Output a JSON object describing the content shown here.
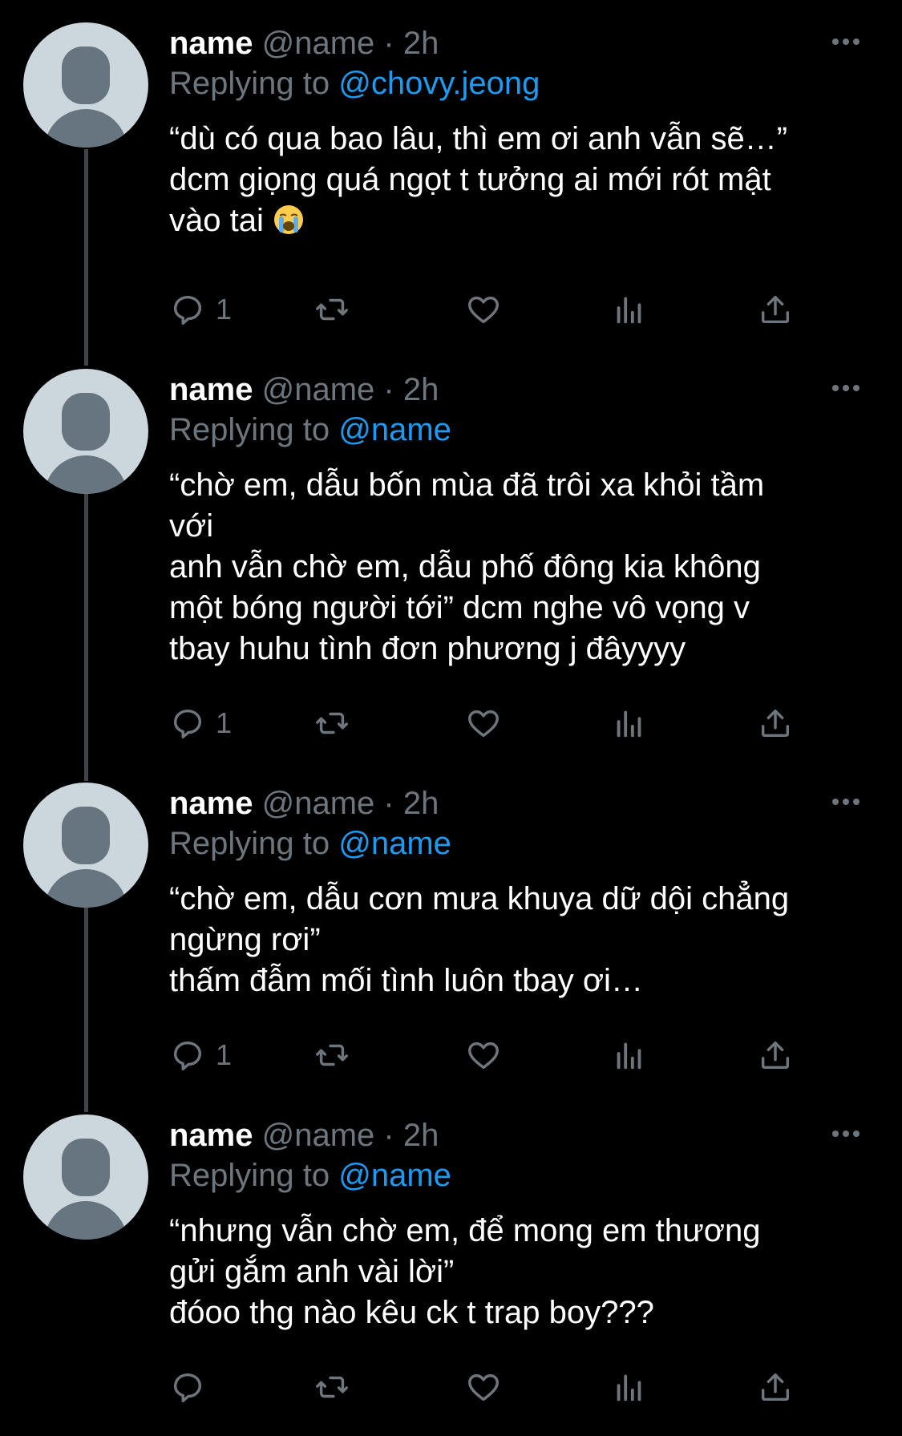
{
  "colors": {
    "background": "#000000",
    "secondary_text": "#6e767d",
    "mention": "#1d9bf0",
    "avatar_bg": "#ccd6dd",
    "avatar_fg": "#66757f",
    "thread_line": "#3f4448"
  },
  "tweets": [
    {
      "name": "name",
      "handle": "@name",
      "dot": "·",
      "time": "2h",
      "replying_prefix": "Replying to",
      "replying_to": "@chovy.jeong",
      "text": "“dù có qua bao lâu, thì em ơi anh vẫn sẽ…”\ndcm giọng quá ngọt t tưởng ai mới rót mật\nvào tai",
      "emoji": "loudly-crying-face-icon",
      "reply_count": "1"
    },
    {
      "name": "name",
      "handle": "@name",
      "dot": "·",
      "time": "2h",
      "replying_prefix": "Replying to",
      "replying_to": "@name",
      "text": "“chờ em, dẫu bốn mùa đã trôi xa khỏi tầm\nvới\nanh vẫn chờ em, dẫu phố đông kia không\nmột bóng người tới” dcm nghe vô vọng v\ntbay huhu tình đơn phương j đâyyyy",
      "reply_count": "1"
    },
    {
      "name": "name",
      "handle": "@name",
      "dot": "·",
      "time": "2h",
      "replying_prefix": "Replying to",
      "replying_to": "@name",
      "text": "“chờ em, dẫu cơn mưa khuya dữ dội chẳng\nngừng rơi”\nthấm đẫm mối tình luôn tbay ơi…",
      "reply_count": "1"
    },
    {
      "name": "name",
      "handle": "@name",
      "dot": "·",
      "time": "2h",
      "replying_prefix": "Replying to",
      "replying_to": "@name",
      "text": "“nhưng vẫn chờ em, để mong em thương\ngửi gắm anh vài lời”\nđóoo thg nào kêu ck t trap boy???",
      "reply_count": ""
    }
  ],
  "icons": {
    "reply": "reply-icon",
    "retweet": "retweet-icon",
    "like": "heart-icon",
    "analytics": "analytics-icon",
    "share": "share-icon",
    "more": "more-icon"
  }
}
